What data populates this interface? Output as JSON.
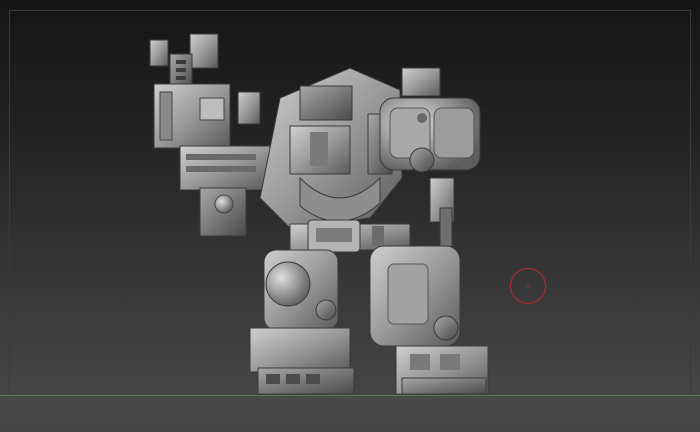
{
  "viewport": {
    "background_top": "#151515",
    "background_bottom": "#4a4a4a",
    "floor_grid_color": "#5c7a4a",
    "brush_cursor_color": "#b42a2a"
  },
  "model": {
    "icon": "mech-robot-sculpt-icon",
    "material": "matcap-grey"
  }
}
